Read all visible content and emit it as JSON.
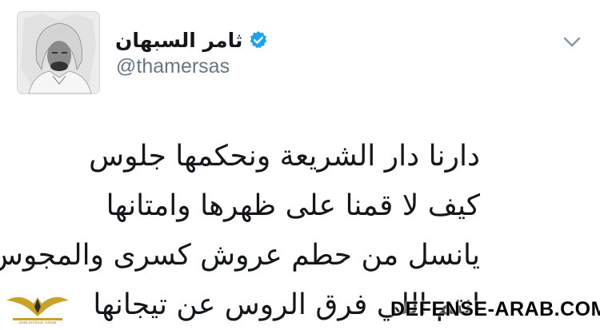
{
  "profile": {
    "display_name": "ثامر السبهان",
    "handle": "@thamersas",
    "verified": true,
    "verified_icon": "verified-badge-icon",
    "avatar_icon": "profile-photo"
  },
  "menu": {
    "icon": "chevron-down-icon"
  },
  "tweet": {
    "lines": [
      "دارنا دار الشريعة ونحكمها جلوس",
      "كيف لا قمنا على ظهرها وامتانها",
      "يانسل من حطم عروش كسرى والمجوس",
      "انتم اللي فرق الروس عن تيجانها"
    ]
  },
  "watermark": {
    "text": "DEFENSE-ARAB.COM",
    "logo_caption": "ARAB DEFENSE FORUM"
  },
  "colors": {
    "verified_blue": "#1da1f2",
    "handle_gray": "#657786",
    "text_dark": "#14171a",
    "watermark_gold": "#c9a227"
  }
}
